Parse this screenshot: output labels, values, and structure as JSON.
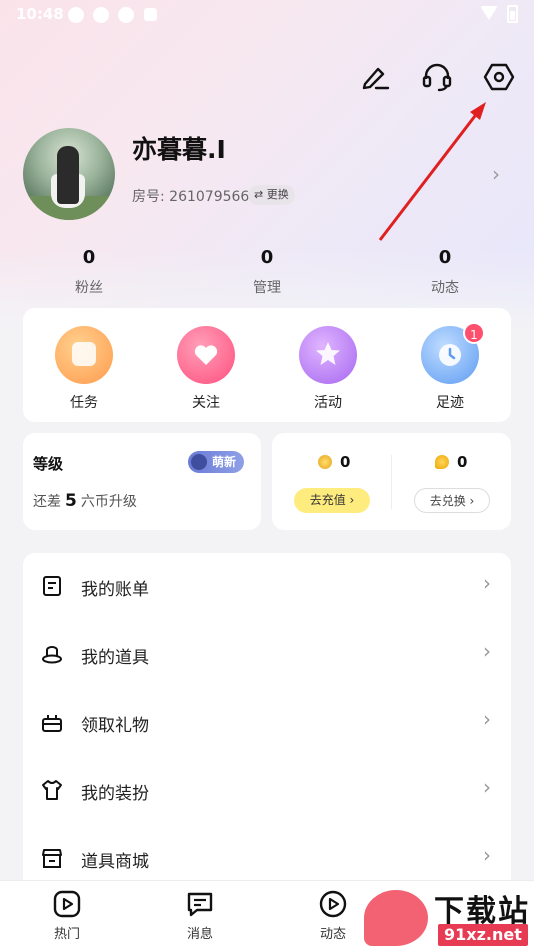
{
  "status_bar": {
    "time": "10:48"
  },
  "profile": {
    "name": "亦暮暮.I",
    "room_label": "房号: ",
    "room_id": "261079566",
    "swap_label": "⇄ 更换"
  },
  "stats": [
    {
      "value": "0",
      "label": "粉丝"
    },
    {
      "value": "0",
      "label": "管理"
    },
    {
      "value": "0",
      "label": "动态"
    }
  ],
  "quick_actions": [
    {
      "label": "任务",
      "icon": "task-icon"
    },
    {
      "label": "关注",
      "icon": "heart-plus-icon"
    },
    {
      "label": "活动",
      "icon": "star-icon"
    },
    {
      "label": "足迹",
      "icon": "clock-icon",
      "badge": "1"
    }
  ],
  "level": {
    "title": "等级",
    "badge": "萌新",
    "desc_prefix": "还差",
    "desc_value": "5",
    "desc_suffix": "六币升级"
  },
  "wallet": {
    "coins": {
      "value": "0",
      "button": "去充值 ›"
    },
    "beans": {
      "value": "0",
      "button": "去兑换 ›"
    }
  },
  "menu": [
    {
      "label": "我的账单",
      "icon": "receipt-icon"
    },
    {
      "label": "我的道具",
      "icon": "hat-icon"
    },
    {
      "label": "领取礼物",
      "icon": "gift-icon"
    },
    {
      "label": "我的装扮",
      "icon": "shirt-icon"
    },
    {
      "label": "道具商城",
      "icon": "shop-icon"
    }
  ],
  "bottom_nav": [
    {
      "label": "热门",
      "icon": "play-square-icon"
    },
    {
      "label": "消息",
      "icon": "message-icon"
    },
    {
      "label": "动态",
      "icon": "play-circle-icon"
    }
  ],
  "watermark": {
    "text": "下载站",
    "url": "91xz.net"
  },
  "colors": {
    "accent_red": "#ff4f6d",
    "task": "#ffb067",
    "follow": "#ff6a8f",
    "activity": "#b77df3",
    "footprint": "#6aa6f5",
    "recharge": "#ffe97a"
  }
}
